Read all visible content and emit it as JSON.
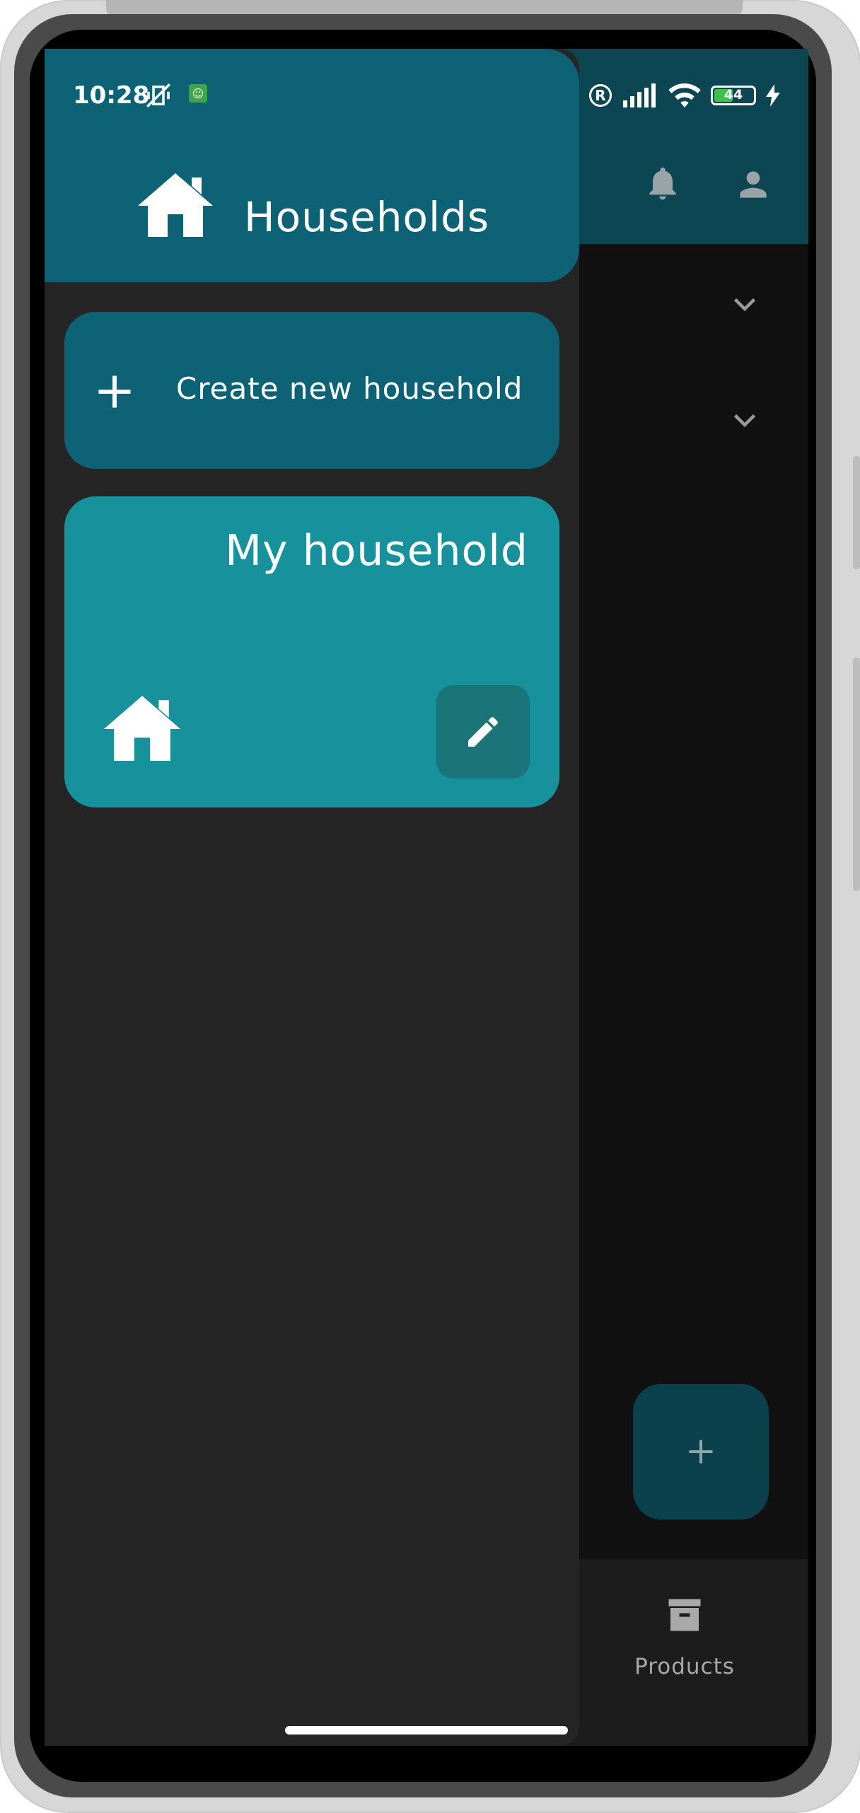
{
  "status_bar": {
    "time": "10:28",
    "registered_symbol": "R",
    "battery_level": "44"
  },
  "app_bar": {
    "notifications_icon": "bell-icon",
    "account_icon": "person-icon"
  },
  "fab": {
    "icon": "plus-icon"
  },
  "bottom_nav": {
    "items": [
      {
        "label": "Products",
        "icon": "archive-box-icon"
      }
    ]
  },
  "drawer": {
    "title": "Households",
    "title_icon": "home-icon",
    "create_button": {
      "label": "Create new household",
      "icon": "plus-icon"
    },
    "households": [
      {
        "name": "My household",
        "icon": "home-icon",
        "edit_icon": "pencil-icon"
      }
    ]
  },
  "colors": {
    "drawer_header": "#0d6276",
    "household_card": "#17919b",
    "edit_button": "#1a7478",
    "app_bar": "#0b4652",
    "drawer_background": "#252525"
  }
}
